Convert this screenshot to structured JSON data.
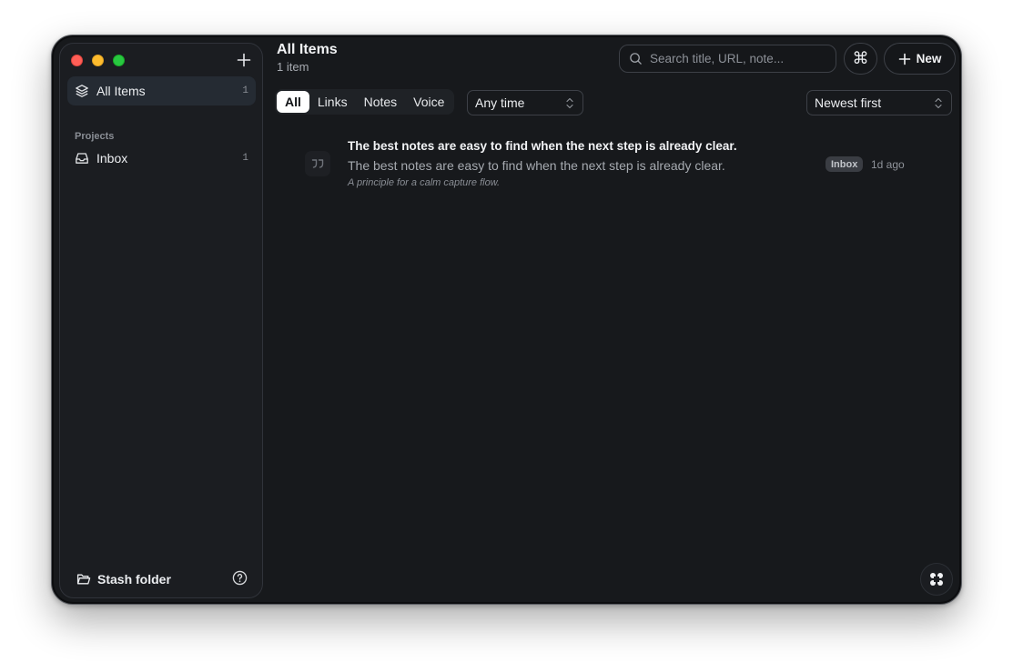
{
  "sidebar": {
    "add_label": "+",
    "nav": [
      {
        "label": "All Items",
        "count": "1",
        "icon": "layers-icon"
      },
      {
        "label": "Inbox",
        "count": "1",
        "icon": "inbox-icon"
      }
    ],
    "section_title": "Projects",
    "stash_label": "Stash folder",
    "help_icon": "help-circle-icon"
  },
  "header": {
    "title": "All Items",
    "subtitle": "1 item",
    "search_placeholder": "Search title, URL, note...",
    "command_symbol": "⌘",
    "new_label": "New"
  },
  "filters": {
    "tabs": [
      "All",
      "Links",
      "Notes",
      "Voice"
    ],
    "active_tab": "All",
    "time_value": "Any time",
    "sort_value": "Newest first"
  },
  "items": [
    {
      "icon": "quote-icon",
      "title": "The best notes are easy to find when the next step is already clear.",
      "body": "The best notes are easy to find when the next step is already clear.",
      "note": "A principle for a calm capture flow.",
      "tag": "Inbox",
      "time": "1d ago"
    }
  ],
  "colors": {
    "window_bg": "#17191c",
    "sidebar_bg": "#1b1d21",
    "active_nav": "#252b33",
    "text_primary": "#f2f3f5",
    "text_muted": "#a6aab0"
  }
}
